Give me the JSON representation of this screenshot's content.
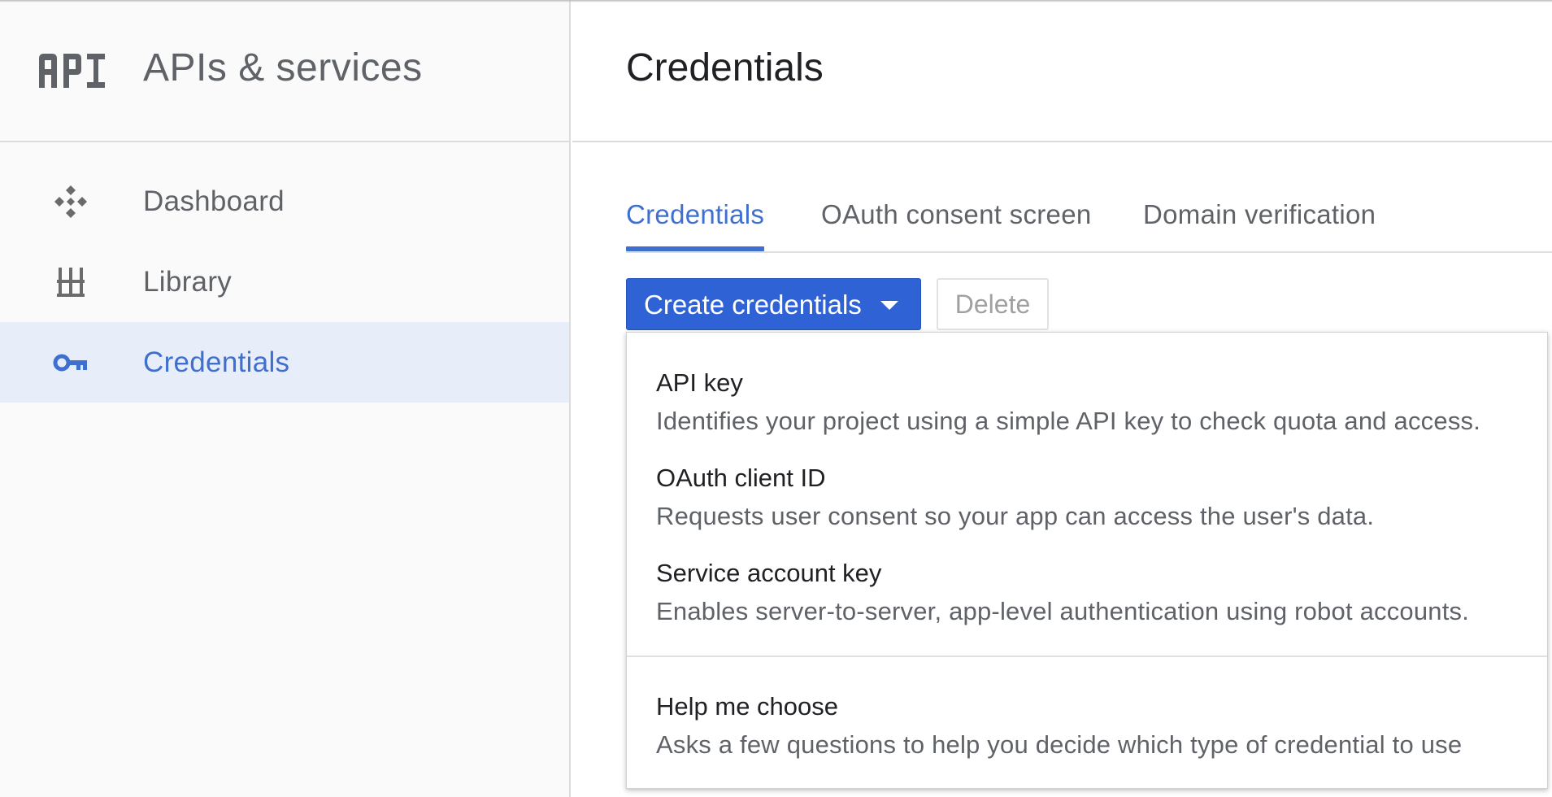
{
  "sidebar": {
    "logo_text": "API",
    "title": "APIs & services",
    "items": [
      {
        "label": "Dashboard",
        "icon": "dashboard-icon",
        "active": false
      },
      {
        "label": "Library",
        "icon": "library-icon",
        "active": false
      },
      {
        "label": "Credentials",
        "icon": "key-icon",
        "active": true
      }
    ]
  },
  "main": {
    "title": "Credentials",
    "tabs": [
      {
        "label": "Credentials",
        "active": true
      },
      {
        "label": "OAuth consent screen",
        "active": false
      },
      {
        "label": "Domain verification",
        "active": false
      }
    ],
    "create_button_label": "Create credentials",
    "delete_button_label": "Delete"
  },
  "dropdown": {
    "items": [
      {
        "title": "API key",
        "description": "Identifies your project using a simple API key to check quota and access."
      },
      {
        "title": "OAuth client ID",
        "description": "Requests user consent so your app can access the user's data."
      },
      {
        "title": "Service account key",
        "description": "Enables server-to-server, app-level authentication using robot accounts."
      }
    ],
    "help": {
      "title": "Help me choose",
      "description": "Asks a few questions to help you decide which type of credential to use"
    }
  },
  "colors": {
    "accent": "#3f6fcf",
    "primary_button": "#2f63d5",
    "active_nav_bg": "#e8eef9",
    "sidebar_bg": "#fafafa"
  }
}
